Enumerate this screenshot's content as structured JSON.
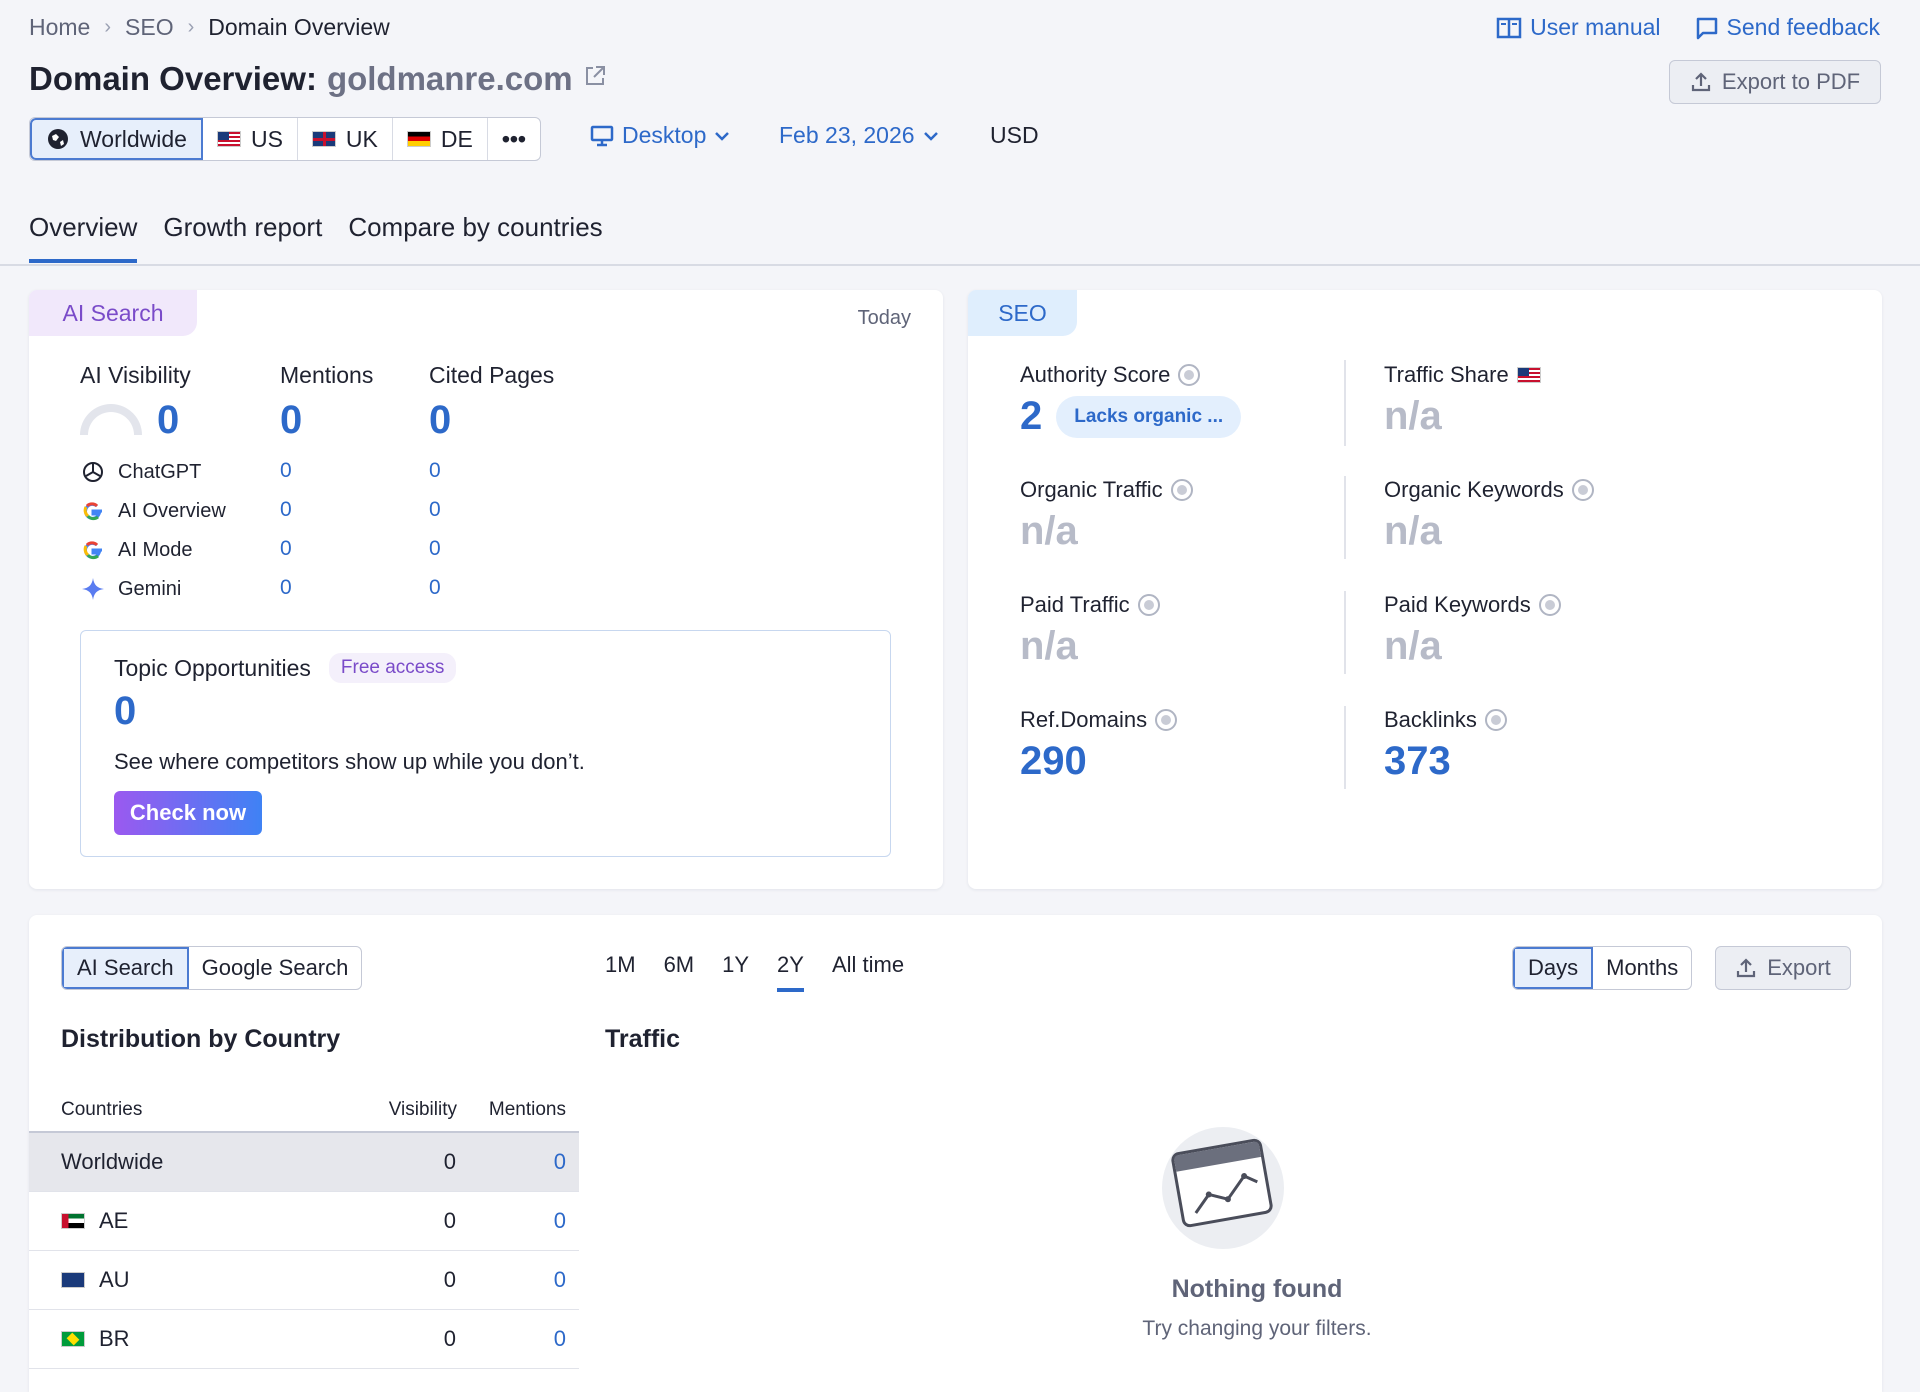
{
  "breadcrumb": {
    "home": "Home",
    "seo": "SEO",
    "current": "Domain Overview"
  },
  "top_links": {
    "manual": "User manual",
    "feedback": "Send feedback"
  },
  "title": {
    "prefix": "Domain Overview:",
    "domain": "goldmanre.com"
  },
  "export_pdf": "Export to PDF",
  "databases": {
    "worldwide": "Worldwide",
    "us": "US",
    "uk": "UK",
    "de": "DE",
    "more": "•••"
  },
  "device": "Desktop",
  "date": "Feb 23, 2026",
  "currency": "USD",
  "tabs": {
    "overview": "Overview",
    "growth": "Growth report",
    "compare": "Compare by countries"
  },
  "ai_card": {
    "badge": "AI Search",
    "today": "Today",
    "labels": {
      "visibility": "AI Visibility",
      "mentions": "Mentions",
      "cited": "Cited Pages"
    },
    "totals": {
      "visibility": "0",
      "mentions": "0",
      "cited": "0"
    },
    "rows": [
      {
        "name": "ChatGPT",
        "mentions": "0",
        "cited": "0"
      },
      {
        "name": "AI Overview",
        "mentions": "0",
        "cited": "0"
      },
      {
        "name": "AI Mode",
        "mentions": "0",
        "cited": "0"
      },
      {
        "name": "Gemini",
        "mentions": "0",
        "cited": "0"
      }
    ],
    "topic": {
      "title": "Topic Opportunities",
      "badge": "Free access",
      "value": "0",
      "desc": "See where competitors show up while you don’t.",
      "button": "Check now"
    }
  },
  "seo_card": {
    "badge": "SEO",
    "authority": {
      "label": "Authority Score",
      "value": "2",
      "note": "Lacks organic ..."
    },
    "traffic_share": {
      "label": "Traffic Share",
      "value": "n/a"
    },
    "organic_traffic": {
      "label": "Organic Traffic",
      "value": "n/a"
    },
    "organic_keywords": {
      "label": "Organic Keywords",
      "value": "n/a"
    },
    "paid_traffic": {
      "label": "Paid Traffic",
      "value": "n/a"
    },
    "paid_keywords": {
      "label": "Paid Keywords",
      "value": "n/a"
    },
    "ref_domains": {
      "label": "Ref.Domains",
      "value": "290"
    },
    "backlinks": {
      "label": "Backlinks",
      "value": "373"
    }
  },
  "bottom": {
    "source_tabs": {
      "ai": "AI Search",
      "google": "Google Search"
    },
    "periods": {
      "m1": "1M",
      "m6": "6M",
      "y1": "1Y",
      "y2": "2Y",
      "all": "All time"
    },
    "granularity": {
      "days": "Days",
      "months": "Months"
    },
    "export": "Export",
    "distribution_title": "Distribution by Country",
    "traffic_title": "Traffic",
    "table_headers": {
      "countries": "Countries",
      "visibility": "Visibility",
      "mentions": "Mentions"
    },
    "table_rows": [
      {
        "country": "Worldwide",
        "visibility": "0",
        "mentions": "0"
      },
      {
        "country": "AE",
        "visibility": "0",
        "mentions": "0"
      },
      {
        "country": "AU",
        "visibility": "0",
        "mentions": "0"
      },
      {
        "country": "BR",
        "visibility": "0",
        "mentions": "0"
      }
    ],
    "empty_title": "Nothing found",
    "empty_sub": "Try changing your filters."
  },
  "colors": {
    "accent": "#2d69c9",
    "ai_purple": "#7a4bc9",
    "na_gray": "#b7bbc8"
  }
}
